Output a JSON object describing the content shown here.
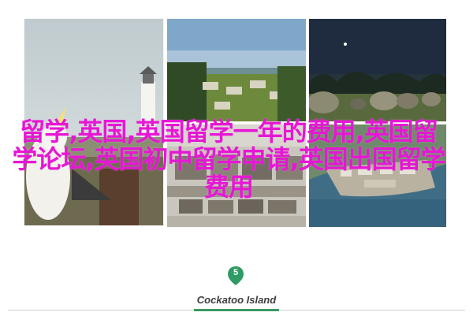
{
  "overlay": {
    "title": "留学,英国,英国留学一年的费用,英国留学论坛,英国初中留学申请,英国出国留学费用"
  },
  "marker": {
    "number": "5",
    "color": "#2e9a64"
  },
  "caption": {
    "text": "Cockatoo Island"
  },
  "colors": {
    "title": "#e617d4",
    "accent": "#3c9a63"
  }
}
